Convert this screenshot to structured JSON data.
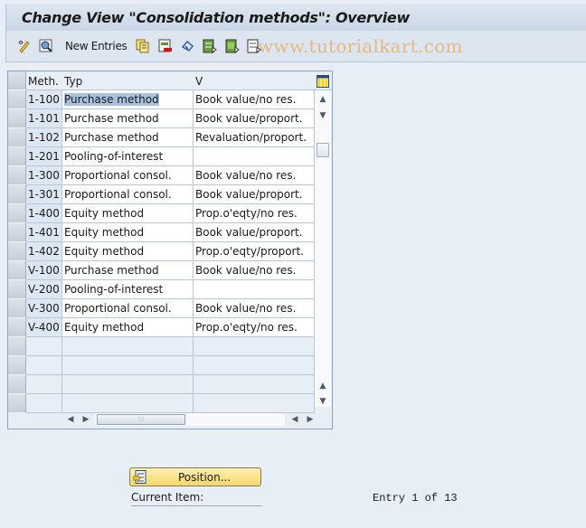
{
  "window": {
    "title": "Change View \"Consolidation methods\": Overview"
  },
  "toolbar": {
    "items": [
      {
        "icon": "display-change-icon"
      },
      {
        "icon": "details-icon"
      },
      {
        "label": "New Entries"
      },
      {
        "icon": "copy-as-icon"
      },
      {
        "icon": "delete-icon"
      },
      {
        "icon": "undo-change-icon"
      },
      {
        "icon": "select-all-icon"
      },
      {
        "icon": "select-block-icon"
      },
      {
        "icon": "deselect-all-icon"
      }
    ],
    "new_entries_label": "New Entries",
    "watermark": "www.tutorialkart.com"
  },
  "table": {
    "columns": [
      "Meth.",
      "Typ",
      "V"
    ],
    "rows": [
      {
        "meth": "1-100",
        "typ": "Purchase method",
        "v": "Book value/no res.",
        "selected": true
      },
      {
        "meth": "1-101",
        "typ": "Purchase method",
        "v": "Book value/proport."
      },
      {
        "meth": "1-102",
        "typ": "Purchase method",
        "v": "Revaluation/proport."
      },
      {
        "meth": "1-201",
        "typ": "Pooling-of-interest",
        "v": ""
      },
      {
        "meth": "1-300",
        "typ": "Proportional consol.",
        "v": "Book value/no res."
      },
      {
        "meth": "1-301",
        "typ": "Proportional consol.",
        "v": "Book value/proport."
      },
      {
        "meth": "1-400",
        "typ": "Equity method",
        "v": "Prop.o'eqty/no res."
      },
      {
        "meth": "1-401",
        "typ": "Equity method",
        "v": "Book value/proport."
      },
      {
        "meth": "1-402",
        "typ": "Equity method",
        "v": "Prop.o'eqty/proport."
      },
      {
        "meth": "V-100",
        "typ": "Purchase method",
        "v": "Book value/no res."
      },
      {
        "meth": "V-200",
        "typ": "Pooling-of-interest",
        "v": ""
      },
      {
        "meth": "V-300",
        "typ": "Proportional consol.",
        "v": "Book value/no res."
      },
      {
        "meth": "V-400",
        "typ": "Equity method",
        "v": "Prop.o'eqty/no res."
      }
    ],
    "empty_rows": 4
  },
  "footer": {
    "position_button": "Position...",
    "current_item_label": "Current Item:",
    "entry_status": "Entry 1 of 13"
  }
}
